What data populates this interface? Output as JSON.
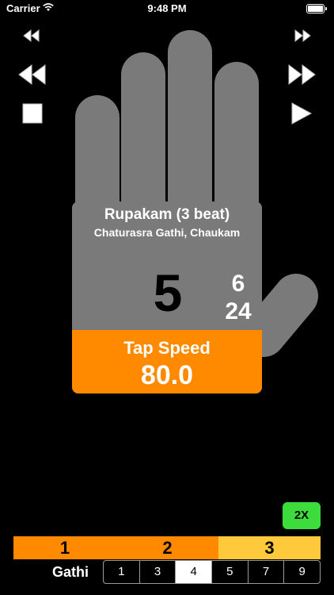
{
  "status_bar": {
    "carrier": "Carrier",
    "time": "9:48 PM"
  },
  "controls": {
    "left": [
      "slow-down-icon",
      "rewind-icon",
      "stop-icon"
    ],
    "right": [
      "speed-up-icon",
      "fast-forward-icon",
      "play-icon"
    ]
  },
  "tala": {
    "name": "Rupakam (3 beat)",
    "subtitle": "Chaturasra Gathi, Chaukam",
    "current_beat": "5",
    "count_top": "6",
    "count_bottom": "24"
  },
  "tap_speed": {
    "label": "Tap Speed",
    "value": "80.0"
  },
  "multiplier_button": "2X",
  "beat_bar": [
    "1",
    "2",
    "3"
  ],
  "gathi": {
    "label": "Gathi",
    "options": [
      "1",
      "3",
      "4",
      "5",
      "7",
      "9"
    ],
    "selected": "4"
  },
  "colors": {
    "hand": "#7a7a7a",
    "accent_orange": "#ff8a00",
    "accent_yellow": "#ffc93c",
    "accent_green": "#3ddc3d"
  }
}
